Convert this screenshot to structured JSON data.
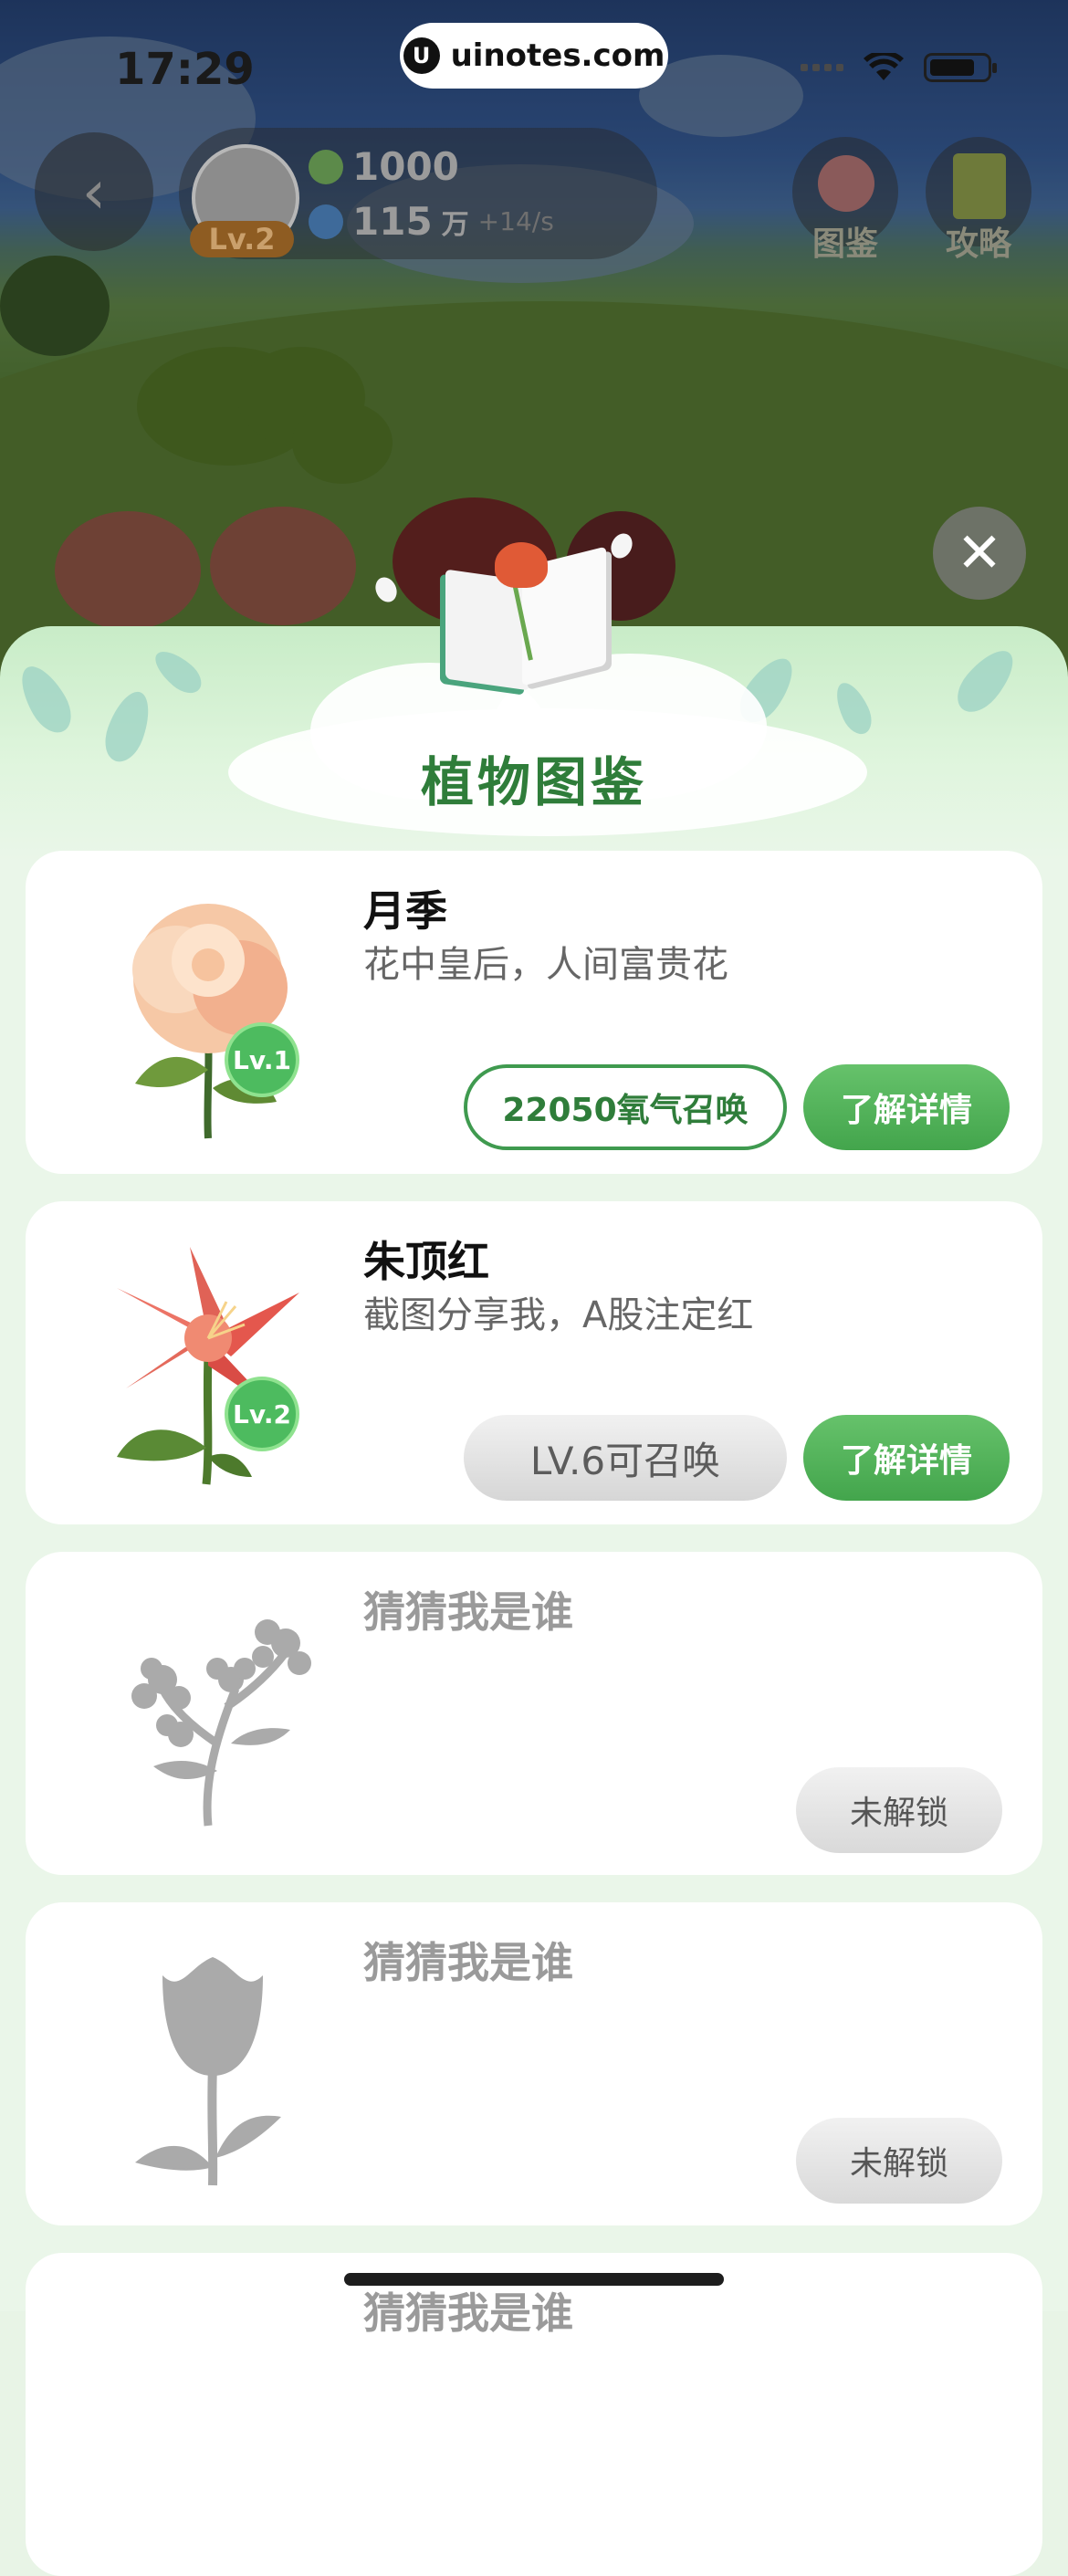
{
  "status_bar": {
    "time": "17:29",
    "url": "uinotes.com",
    "logo_glyph": "U"
  },
  "hud": {
    "back_glyph": "‹",
    "level": "Lv.2",
    "energy": "1000",
    "coins_value": "115",
    "coins_unit": "万",
    "coins_rate": "+14/s",
    "guide_label": "图鉴",
    "strategy_label": "攻略"
  },
  "modal": {
    "close_glyph": "✕",
    "title": "植物图鉴",
    "plants": [
      {
        "name": "月季",
        "desc": "花中皇后，人间富贵花",
        "level": "Lv.1",
        "summon_label": "22050氧气召唤",
        "detail_label": "了解详情"
      },
      {
        "name": "朱顶红",
        "desc": "截图分享我，A股注定红",
        "level": "Lv.2",
        "summon_label": "LV.6可召唤",
        "detail_label": "了解详情"
      },
      {
        "name": "猜猜我是谁",
        "lock_label": "未解锁"
      },
      {
        "name": "猜猜我是谁",
        "lock_label": "未解锁"
      },
      {
        "name": "猜猜我是谁"
      }
    ]
  },
  "colors": {
    "accent_green": "#43a54c",
    "title_green": "#2f7d3a"
  }
}
